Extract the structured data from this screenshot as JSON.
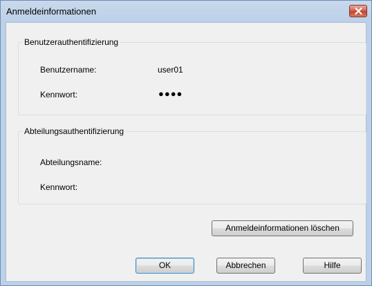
{
  "window": {
    "title": "Anmeldeinformationen"
  },
  "user_auth": {
    "legend": "Benutzerauthentifizierung",
    "username_label": "Benutzername:",
    "username_value": "user01",
    "password_label": "Kennwort:",
    "password_value": "●●●●"
  },
  "dept_auth": {
    "legend": "Abteilungsauthentifizierung",
    "dept_name_label": "Abteilungsname:",
    "dept_name_value": "",
    "password_label": "Kennwort:",
    "password_value": ""
  },
  "buttons": {
    "clear": "Anmeldeinformationen löschen",
    "ok": "OK",
    "cancel": "Abbrechen",
    "help": "Hilfe"
  },
  "icons": {
    "close": "close-icon"
  }
}
